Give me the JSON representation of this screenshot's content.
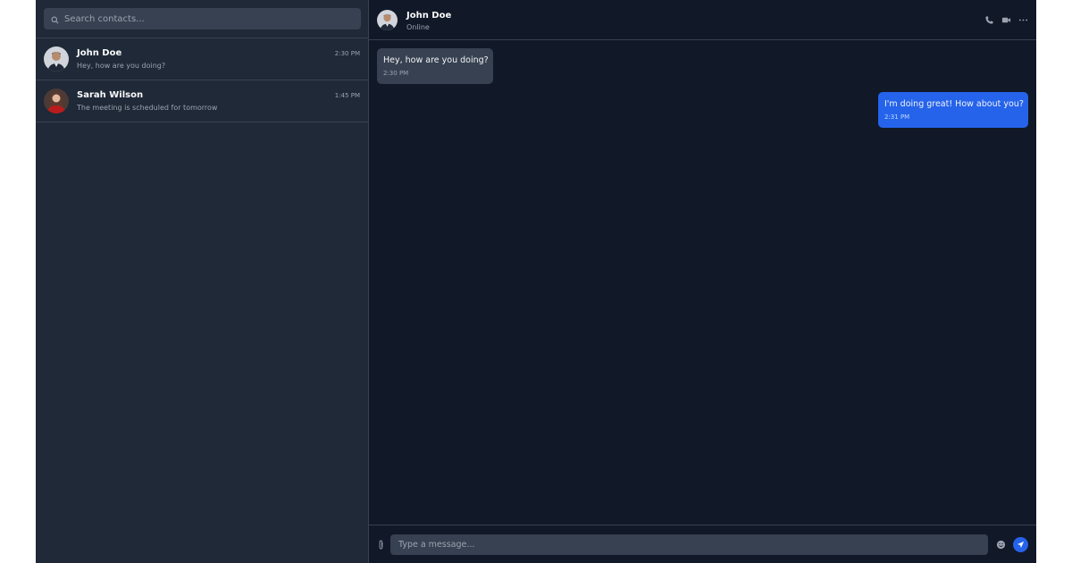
{
  "colors": {
    "sidebar_bg": "#1f2937",
    "chat_bg": "#111827",
    "border": "#374151",
    "accent": "#2563eb",
    "incoming_bubble": "#374151"
  },
  "search": {
    "placeholder": "Search contacts..."
  },
  "contacts": [
    {
      "name": "John Doe",
      "time": "2:30 PM",
      "preview": "Hey, how are you doing?",
      "avatar_icon": "person-avatar-icon"
    },
    {
      "name": "Sarah Wilson",
      "time": "1:45 PM",
      "preview": "The meeting is scheduled for tomorrow",
      "avatar_icon": "person-avatar-icon"
    }
  ],
  "chat_header": {
    "name": "John Doe",
    "status": "Online",
    "actions": [
      "phone-icon",
      "video-icon",
      "more-icon"
    ]
  },
  "messages": [
    {
      "direction": "incoming",
      "text": "Hey, how are you doing?",
      "time": "2:30 PM"
    },
    {
      "direction": "outgoing",
      "text": "I'm doing great! How about you?",
      "time": "2:31 PM"
    }
  ],
  "composer": {
    "placeholder": "Type a message...",
    "icons": [
      "paperclip-icon",
      "emoji-icon",
      "send-icon"
    ]
  }
}
